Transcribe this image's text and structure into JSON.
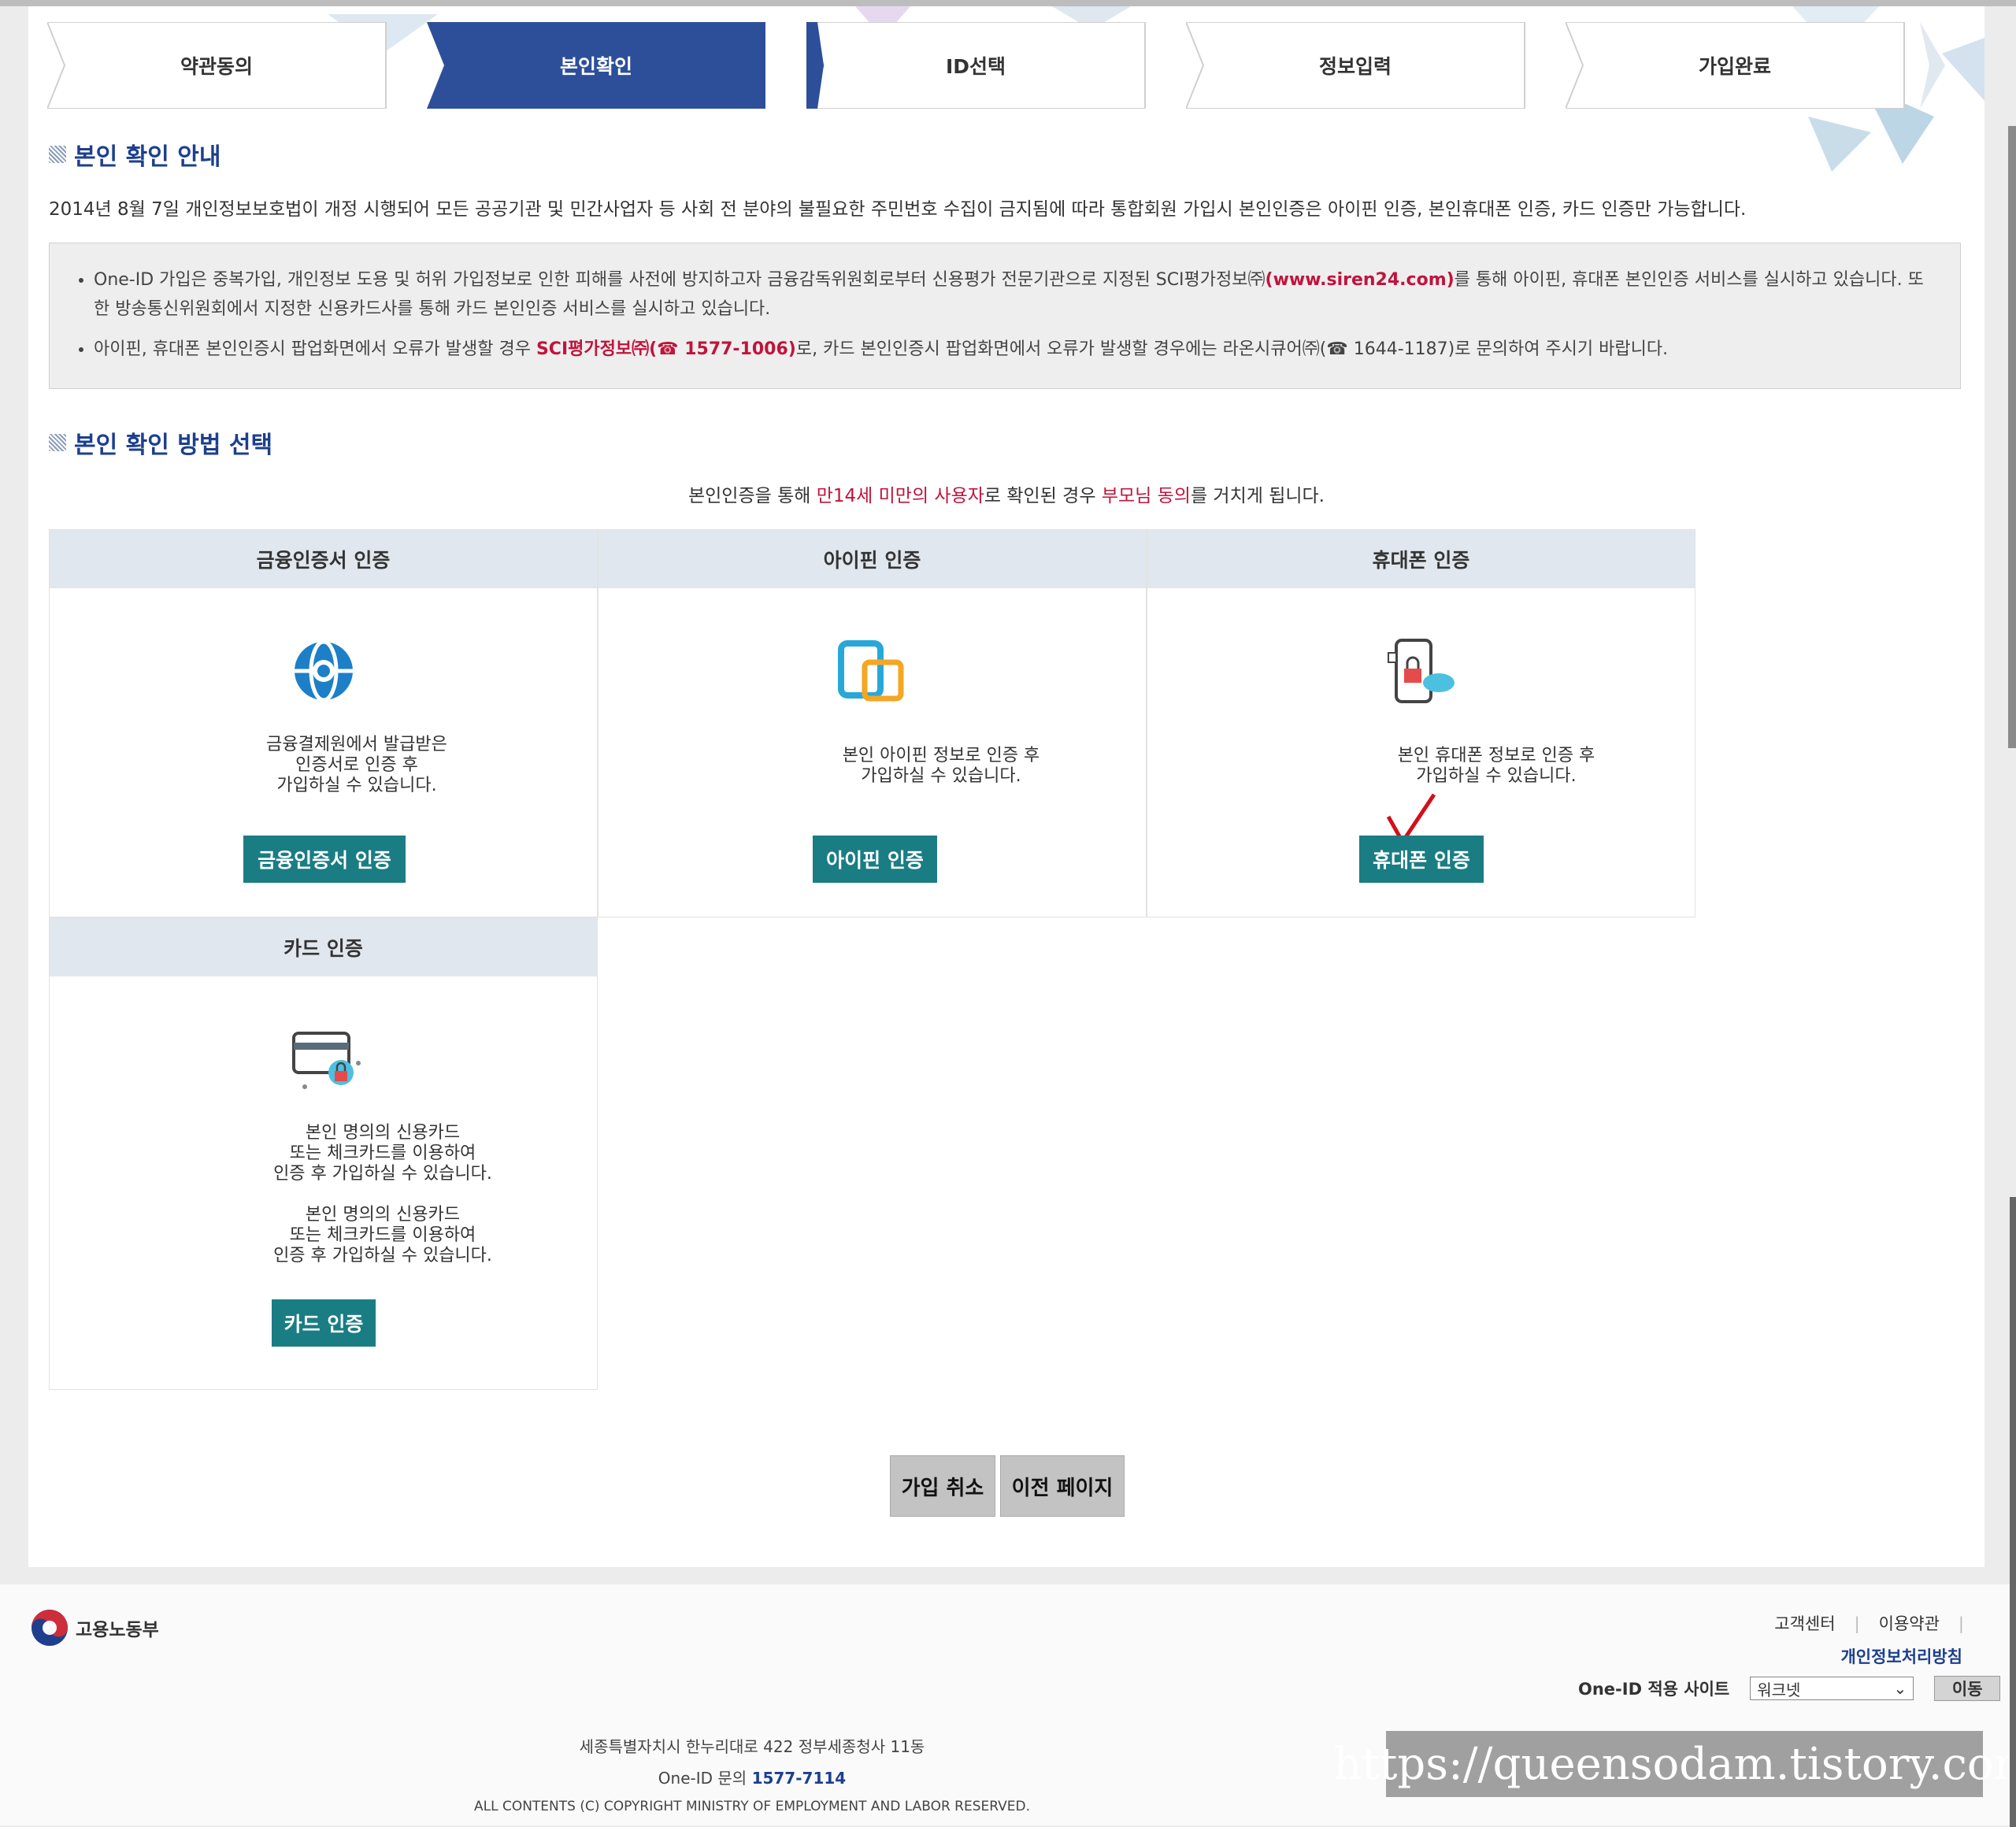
{
  "steps": [
    {
      "label": "약관동의"
    },
    {
      "label": "본인확인"
    },
    {
      "label": "ID선택"
    },
    {
      "label": "정보입력"
    },
    {
      "label": "가입완료"
    }
  ],
  "active_step": "본인확인",
  "section1": {
    "title": "본인 확인 안내",
    "intro": "2014년 8월 7일 개인정보보호법이 개정 시행되어 모든 공공기관 및 민간사업자 등 사회 전 분야의 불필요한 주민번호 수집이 금지됨에 따라 통합회원 가입시 본인인증은 아이핀 인증, 본인휴대폰 인증, 카드 인증만 가능합니다.",
    "notice1_a": "One-ID 가입은 중복가입, 개인정보 도용 및 허위 가입정보로 인한 피해를 사전에 방지하고자 금융감독위원회로부터 신용평가 전문기관으로 지정된 SCI평가정보㈜",
    "notice1_link": "(www.siren24.com)",
    "notice1_b": "를 통해 아이핀, 휴대폰 본인인증 서비스를 실시하고 있습니다. 또한 방송통신위원회에서 지정한 신용카드사를 통해 카드 본인인증 서비스를 실시하고 있습니다.",
    "notice2_a": "아이핀, 휴대폰 본인인증시 팝업화면에서 오류가 발생할 경우 ",
    "notice2_red": "SCI평가정보㈜(☎ 1577-1006)",
    "notice2_b": "로, 카드 본인인증시 팝업화면에서 오류가 발생할 경우에는 라온시큐어㈜(☎ 1644-1187)로 문의하여 주시기 바랍니다."
  },
  "section2": {
    "title": "본인 확인 방법 선택",
    "guide_a": "본인인증을 통해 ",
    "guide_red1": "만14세 미만의 사용자",
    "guide_b": "로 확인된 경우 ",
    "guide_red2": "부모님 동의",
    "guide_c": "를 거치게 됩니다."
  },
  "methods": [
    {
      "title": "금융인증서 인증",
      "desc": "금융결제원에서 발급받은\n인증서로 인증 후\n가입하실 수 있습니다.",
      "button": "금융인증서 인증",
      "icon": "globe-icon"
    },
    {
      "title": "아이핀 인증",
      "desc": "본인 아이핀 정보로 인증 후\n가입하실 수 있습니다.",
      "button": "아이핀 인증",
      "icon": "ipin-icon"
    },
    {
      "title": "휴대폰 인증",
      "desc": "본인 휴대폰 정보로 인증 후\n가입하실 수 있습니다.",
      "button": "휴대폰 인증",
      "icon": "phone-lock-icon"
    },
    {
      "title": "카드 인증",
      "desc": "본인 명의의 신용카드\n또는 체크카드를 이용하여\n인증 후 가입하실 수 있습니다.\n\n본인 명의의 신용카드\n또는 체크카드를 이용하여\n인증 후 가입하실 수 있습니다.",
      "button": "카드 인증",
      "icon": "card-lock-icon"
    }
  ],
  "actions": {
    "cancel": "가입 취소",
    "prev": "이전 페이지"
  },
  "footer": {
    "logo_text": "고용노동부",
    "link_support": "고객센터",
    "link_terms": "이용약관",
    "link_privacy": "개인정보처리방침",
    "site_label": "One-ID 적용 사이트",
    "site_value": "워크넷",
    "go": "이동",
    "address": "세종특별자치시 한누리대로 422 정부세종청사 11동",
    "inquiry_label": "One-ID 문의",
    "inquiry_phone": "1577-7114",
    "copyright": "ALL CONTENTS (C) COPYRIGHT MINISTRY OF EMPLOYMENT AND LABOR RESERVED."
  },
  "watermark": "https://queensodam.tistory.com",
  "colors": {
    "accent": "#1c3f8f",
    "button": "#1a7d84",
    "highlight": "#c0143c"
  }
}
